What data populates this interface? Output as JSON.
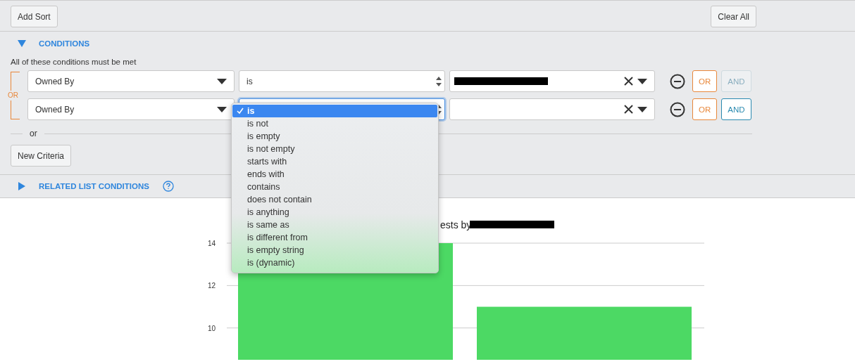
{
  "toolbar": {
    "buttons": [
      {
        "label": "Add Sort"
      },
      {
        "label": "Clear All"
      }
    ]
  },
  "conditions": {
    "title": "CONDITIONS",
    "expanded": true,
    "subtitle": "All of these conditions must be met",
    "group_label": "OR",
    "rows": [
      {
        "field": "Owned By",
        "operator": "is",
        "value_redacted": true,
        "focused": false,
        "or_label": "OR",
        "and_label": "AND",
        "and_disabled": true
      },
      {
        "field": "Owned By",
        "value_redacted": false,
        "focused": true,
        "or_label": "OR",
        "and_label": "AND",
        "and_disabled": false
      }
    ],
    "separator": "or",
    "new_button": "New Criteria"
  },
  "related": {
    "title": "RELATED LIST CONDITIONS",
    "expanded": false
  },
  "operator_menu": {
    "items": [
      {
        "label": "is",
        "selected": true
      },
      {
        "label": "is not",
        "selected": false
      },
      {
        "label": "is empty",
        "selected": false
      },
      {
        "label": "is not empty",
        "selected": false
      },
      {
        "label": "starts with",
        "selected": false
      },
      {
        "label": "ends with",
        "selected": false
      },
      {
        "label": "contains",
        "selected": false
      },
      {
        "label": "does not contain",
        "selected": false
      },
      {
        "label": "is anything",
        "selected": false
      },
      {
        "label": "is same as",
        "selected": false
      },
      {
        "label": "is different from",
        "selected": false
      },
      {
        "label": "is empty string",
        "selected": false
      },
      {
        "label": "is (dynamic)",
        "selected": false
      }
    ]
  },
  "chart": {
    "title_redacted": true,
    "chart_data": {
      "type": "bar",
      "title": "ests by",
      "values": [
        14,
        11
      ],
      "yticks": [
        10,
        12,
        14
      ],
      "ylim": [
        8.5,
        14
      ],
      "grid": true,
      "color": "#4cd964"
    }
  }
}
